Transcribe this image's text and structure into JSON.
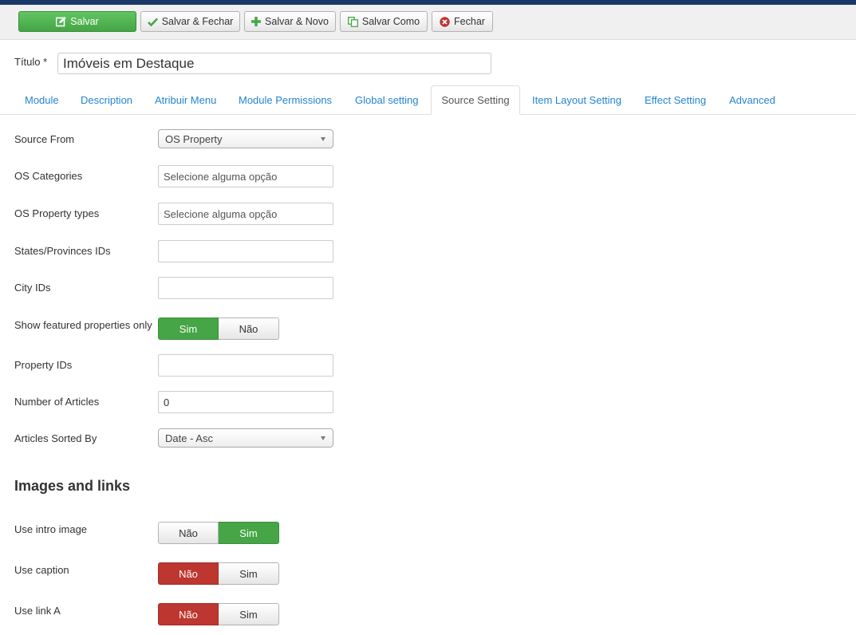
{
  "toolbar": {
    "save": "Salvar",
    "save_close": "Salvar & Fechar",
    "save_new": "Salvar & Novo",
    "save_as": "Salvar Como",
    "close": "Fechar"
  },
  "title_field": {
    "label": "Título *",
    "value": "Imóveis em Destaque"
  },
  "tabs": [
    {
      "label": "Module"
    },
    {
      "label": "Description"
    },
    {
      "label": "Atribuir Menu"
    },
    {
      "label": "Module Permissions"
    },
    {
      "label": "Global setting"
    },
    {
      "label": "Source Setting",
      "active": true
    },
    {
      "label": "Item Layout Setting"
    },
    {
      "label": "Effect Setting"
    },
    {
      "label": "Advanced"
    }
  ],
  "form": {
    "source_from": {
      "label": "Source From",
      "value": "OS Property"
    },
    "os_categories": {
      "label": "OS Categories",
      "placeholder": "Selecione alguma opção"
    },
    "os_property_types": {
      "label": "OS Property types",
      "placeholder": "Selecione alguma opção"
    },
    "states_ids": {
      "label": "States/Provinces IDs",
      "value": ""
    },
    "city_ids": {
      "label": "City IDs",
      "value": ""
    },
    "featured_only": {
      "label": "Show featured properties only",
      "options": [
        "Sim",
        "Não"
      ],
      "selected": "Sim"
    },
    "property_ids": {
      "label": "Property IDs",
      "value": ""
    },
    "number_of_articles": {
      "label": "Number of Articles",
      "value": "0"
    },
    "articles_sorted_by": {
      "label": "Articles Sorted By",
      "value": "Date - Asc"
    }
  },
  "images_links": {
    "heading": "Images and links",
    "use_intro_image": {
      "label": "Use intro image",
      "options": [
        "Não",
        "Sim"
      ],
      "selected": "Sim"
    },
    "use_caption": {
      "label": "Use caption",
      "options": [
        "Não",
        "Sim"
      ],
      "selected": "Não"
    },
    "use_link_a": {
      "label": "Use link A",
      "options": [
        "Não",
        "Sim"
      ],
      "selected": "Não"
    }
  },
  "colors": {
    "brand_bar": "#1a3867",
    "success": "#46a546",
    "danger": "#bd362f",
    "link": "#2384d3"
  },
  "icons": {
    "save": "edit-icon",
    "save_close": "check-icon",
    "save_new": "plus-icon",
    "save_as": "copy-icon",
    "close": "close-circle-icon"
  }
}
